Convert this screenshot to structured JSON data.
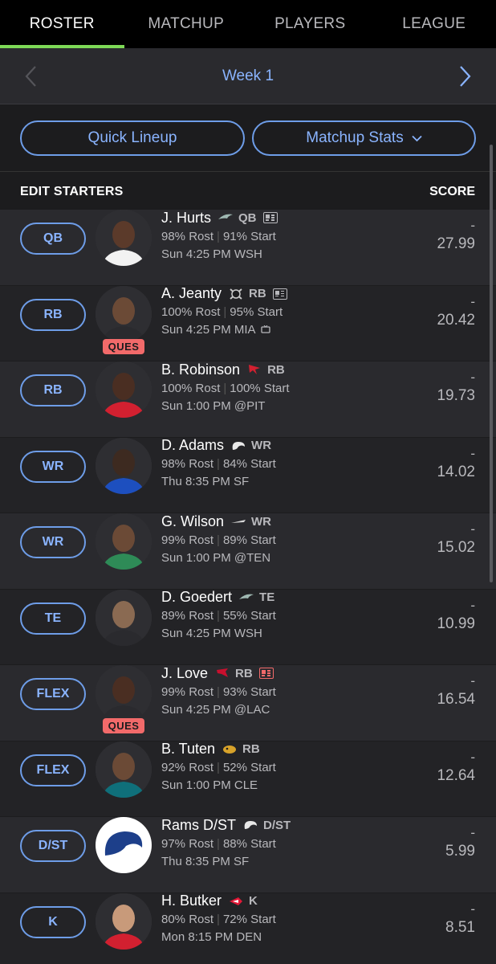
{
  "tabs": [
    "ROSTER",
    "MATCHUP",
    "PLAYERS",
    "LEAGUE"
  ],
  "active_tab": "ROSTER",
  "week": {
    "label": "Week 1"
  },
  "buttons": {
    "quick_lineup": "Quick Lineup",
    "matchup_stats": "Matchup Stats"
  },
  "section": {
    "left": "EDIT STARTERS",
    "right": "SCORE"
  },
  "colors": {
    "accent_green": "#7ed957",
    "link_blue": "#8ab4ff",
    "ques_red": "#f26a6a"
  },
  "rows": [
    {
      "slot": "QB",
      "name": "J. Hurts",
      "team_icon": "eagles-logo-icon",
      "pos": "QB",
      "news": "news-icon",
      "rost": "98% Rost",
      "start": "91% Start",
      "game": "Sun 4:25 PM WSH",
      "status": "",
      "score": "-",
      "proj": "27.99"
    },
    {
      "slot": "RB",
      "name": "A. Jeanty",
      "team_icon": "raiders-logo-icon",
      "pos": "RB",
      "news": "news-icon",
      "rost": "100% Rost",
      "start": "95% Start",
      "game": "Sun 4:25 PM MIA",
      "status": "QUES",
      "score": "-",
      "proj": "20.42"
    },
    {
      "slot": "RB",
      "name": "B. Robinson",
      "team_icon": "falcons-logo-icon",
      "pos": "RB",
      "news": "",
      "rost": "100% Rost",
      "start": "100% Start",
      "game": "Sun 1:00 PM @PIT",
      "status": "",
      "score": "-",
      "proj": "19.73"
    },
    {
      "slot": "WR",
      "name": "D. Adams",
      "team_icon": "rams-logo-icon",
      "pos": "WR",
      "news": "",
      "rost": "98% Rost",
      "start": "84% Start",
      "game": "Thu 8:35 PM SF",
      "status": "",
      "score": "-",
      "proj": "14.02"
    },
    {
      "slot": "WR",
      "name": "G. Wilson",
      "team_icon": "jets-logo-icon",
      "pos": "WR",
      "news": "",
      "rost": "99% Rost",
      "start": "89% Start",
      "game": "Sun 1:00 PM @TEN",
      "status": "",
      "score": "-",
      "proj": "15.02"
    },
    {
      "slot": "TE",
      "name": "D. Goedert",
      "team_icon": "eagles-logo-icon",
      "pos": "TE",
      "news": "",
      "rost": "89% Rost",
      "start": "55% Start",
      "game": "Sun 4:25 PM WSH",
      "status": "",
      "score": "-",
      "proj": "10.99"
    },
    {
      "slot": "FLEX",
      "name": "J. Love",
      "team_icon": "cardinals-logo-icon",
      "pos": "RB",
      "news": "news-red-icon",
      "rost": "99% Rost",
      "start": "93% Start",
      "game": "Sun 4:25 PM @LAC",
      "status": "QUES",
      "score": "-",
      "proj": "16.54"
    },
    {
      "slot": "FLEX",
      "name": "B. Tuten",
      "team_icon": "jaguars-logo-icon",
      "pos": "RB",
      "news": "",
      "rost": "92% Rost",
      "start": "52% Start",
      "game": "Sun 1:00 PM CLE",
      "status": "",
      "score": "-",
      "proj": "12.64"
    },
    {
      "slot": "D/ST",
      "name": "Rams D/ST",
      "team_icon": "rams-logo-icon",
      "pos": "D/ST",
      "news": "",
      "rost": "97% Rost",
      "start": "88% Start",
      "game": "Thu 8:35 PM SF",
      "status": "",
      "score": "-",
      "proj": "5.99"
    },
    {
      "slot": "K",
      "name": "H. Butker",
      "team_icon": "chiefs-logo-icon",
      "pos": "K",
      "news": "",
      "rost": "80% Rost",
      "start": "72% Start",
      "game": "Mon 8:15 PM DEN",
      "status": "",
      "score": "-",
      "proj": "8.51"
    }
  ]
}
